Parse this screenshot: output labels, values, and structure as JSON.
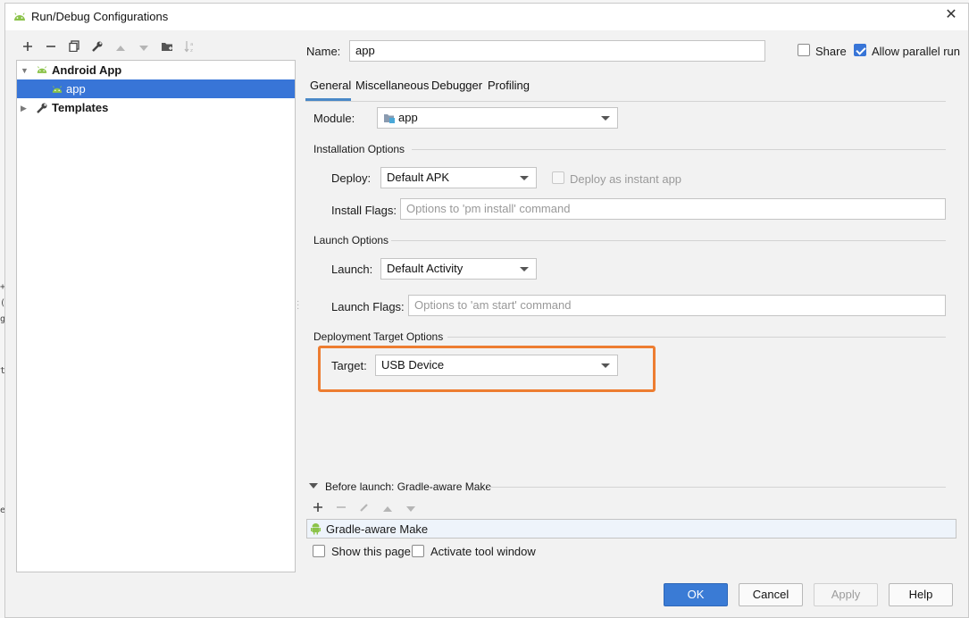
{
  "window": {
    "title": "Run/Debug Configurations",
    "icon": "android-icon",
    "close_glyph": "✕"
  },
  "left_toolbar": [
    {
      "name": "add",
      "glyph": "+",
      "enabled": true
    },
    {
      "name": "remove",
      "glyph": "−",
      "enabled": true
    },
    {
      "name": "copy",
      "glyph": "⧉",
      "enabled": true
    },
    {
      "name": "edit-templates",
      "glyph": "🔧",
      "enabled": true
    },
    {
      "name": "move-up",
      "glyph": "▲",
      "enabled": false
    },
    {
      "name": "move-down",
      "glyph": "▼",
      "enabled": false
    },
    {
      "name": "new-folder",
      "glyph": "📁",
      "enabled": true
    },
    {
      "name": "sort",
      "glyph": "↓a",
      "enabled": false
    }
  ],
  "tree": {
    "items": [
      {
        "label": "Android App",
        "bold": true,
        "expanded": true,
        "icon": "android-icon"
      },
      {
        "label": "app",
        "bold": false,
        "selected": true,
        "icon": "android-icon"
      },
      {
        "label": "Templates",
        "bold": true,
        "expanded": false,
        "icon": "wrench-icon"
      }
    ]
  },
  "header": {
    "name_label": "Name:",
    "name_value": "app",
    "share_label": "Share",
    "share_checked": false,
    "parallel_label": "Allow parallel run",
    "parallel_checked": true
  },
  "tabs": [
    "General",
    "Miscellaneous",
    "Debugger",
    "Profiling"
  ],
  "active_tab": "General",
  "general": {
    "module_label": "Module:",
    "module_value": "app",
    "installation_section": "Installation Options",
    "deploy_label": "Deploy:",
    "deploy_value": "Default APK",
    "instant_app_label": "Deploy as instant app",
    "install_flags_label": "Install Flags:",
    "install_flags_placeholder": "Options to 'pm install' command",
    "launch_section": "Launch Options",
    "launch_label": "Launch:",
    "launch_value": "Default Activity",
    "launch_flags_label": "Launch Flags:",
    "launch_flags_placeholder": "Options to 'am start' command",
    "deployment_section": "Deployment Target Options",
    "target_label": "Target:",
    "target_value": "USB Device"
  },
  "before_launch": {
    "title": "Before launch: Gradle-aware Make",
    "items": [
      "Gradle-aware Make"
    ],
    "show_page_label": "Show this page",
    "activate_tool_label": "Activate tool window"
  },
  "buttons": {
    "ok": "OK",
    "cancel": "Cancel",
    "apply": "Apply",
    "help": "Help"
  },
  "colors": {
    "accent": "#3875d7",
    "highlight": "#ed7d31",
    "android": "#8bc34a"
  }
}
